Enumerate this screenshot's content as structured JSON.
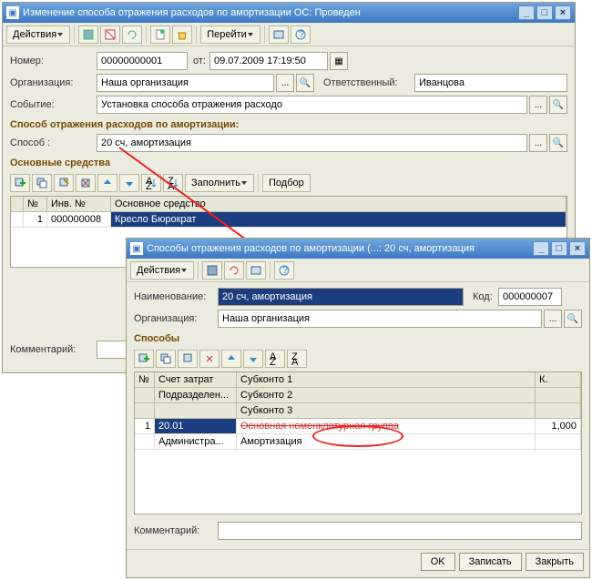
{
  "win1": {
    "title": "Изменение способа отражения расходов по амортизации ОС: Проведен",
    "menu": {
      "actions": "Действия",
      "goto": "Перейти"
    },
    "fields": {
      "number_lbl": "Номер:",
      "number": "00000000001",
      "from_lbl": "от:",
      "from": "09.07.2009 17:19:50",
      "org_lbl": "Организация:",
      "org": "Наша организация",
      "resp_lbl": "Ответственный:",
      "resp": "Иванцова",
      "event_lbl": "Событие:",
      "event": "Установка способа отражения расходо"
    },
    "section1": "Способ отражения расходов по амортизации:",
    "method_lbl": "Способ :",
    "method": "20 сч, амортизация",
    "section2": "Основные средства",
    "tools": {
      "fill": "Заполнить",
      "pick": "Подбор"
    },
    "grid": {
      "cols": {
        "n": "№",
        "inv": "Инв. №",
        "os": "Основное средство"
      },
      "row": {
        "n": "1",
        "inv": "000000008",
        "os": "Кресло Бюрократ"
      }
    },
    "comment_lbl": "Комментарий:"
  },
  "win2": {
    "title": "Способы отражения расходов по амортизации (...: 20 сч, амортизация",
    "menu": {
      "actions": "Действия"
    },
    "fields": {
      "name_lbl": "Наименование:",
      "name": "20 сч, амортизация",
      "code_lbl": "Код:",
      "code": "000000007",
      "org_lbl": "Организация:",
      "org": "Наша организация"
    },
    "section": "Способы",
    "grid": {
      "hdr": {
        "n": "№",
        "acct": "Счет затрат",
        "dept": "Подразделен...",
        "sub1": "Субконто 1",
        "sub2": "Субконто 2",
        "sub3": "Субконто 3",
        "k": "К."
      },
      "row": {
        "n": "1",
        "acct": "20.01",
        "dept": "Администра...",
        "sub1": "Основная номенклатурная группа",
        "sub2": "Амортизация",
        "k": "1,000"
      }
    },
    "comment_lbl": "Комментарий:",
    "footer": {
      "ok": "OK",
      "save": "Записать",
      "close": "Закрыть"
    }
  }
}
